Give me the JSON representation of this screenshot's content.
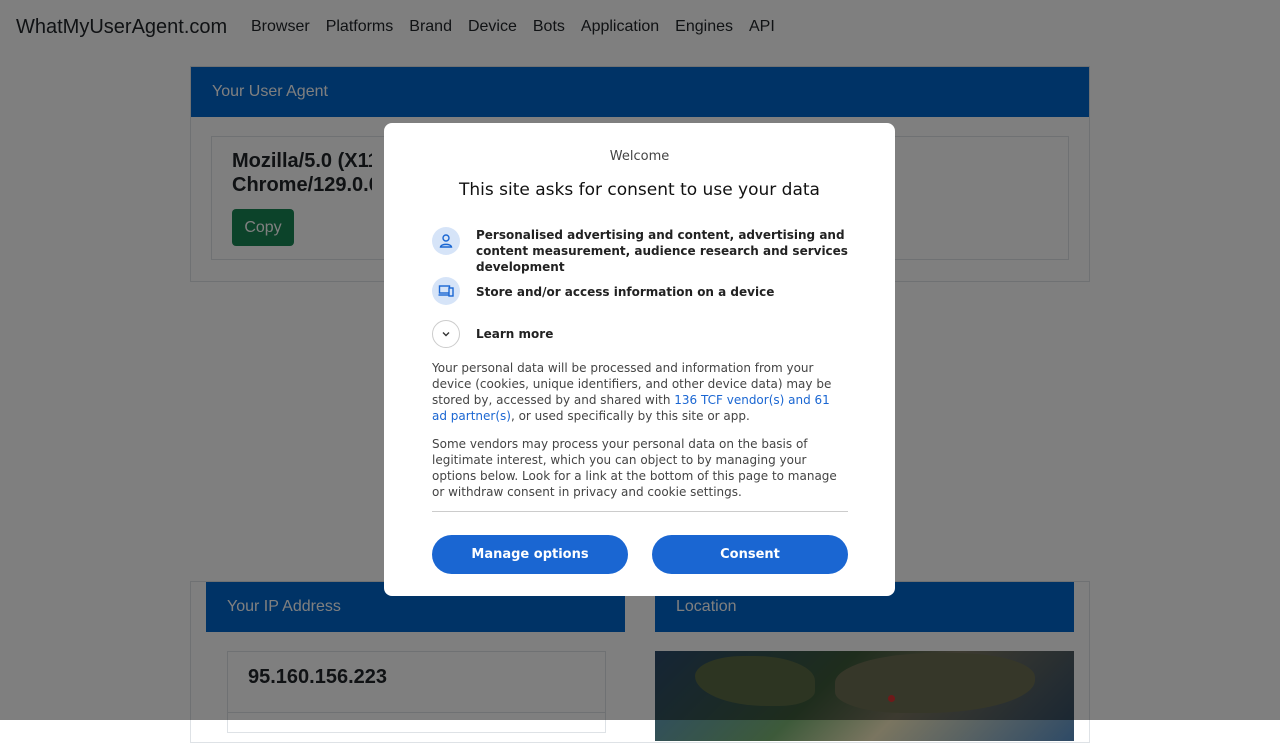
{
  "site": {
    "brand": "WhatMyUserAgent.com"
  },
  "nav": {
    "items": [
      "Browser",
      "Platforms",
      "Brand",
      "Device",
      "Bots",
      "Application",
      "Engines",
      "API"
    ]
  },
  "user_agent_card": {
    "title": "Your User Agent",
    "line1": "Mozilla/5.0 (X11; ",
    "line2": "Chrome/129.0.0.",
    "copy_label": "Copy"
  },
  "ip_card": {
    "title": "Your IP Address",
    "ip": "95.160.156.223"
  },
  "location_card": {
    "title": "Location"
  },
  "consent": {
    "welcome": "Welcome",
    "title": "This site asks for consent to use your data",
    "purposes": [
      {
        "icon": "person-icon",
        "text": "Personalised advertising and content, advertising and content measurement, audience research and services development"
      },
      {
        "icon": "devices-icon",
        "text": "Store and/or access information on a device"
      }
    ],
    "learn_more": "Learn more",
    "para1_before": "Your personal data will be processed and information from your device (cookies, unique identifiers, and other device data) may be stored by, accessed by and shared with ",
    "para1_link": "136 TCF vendor(s) and 61 ad partner(s)",
    "para1_after": ", or used specifically by this site or app.",
    "para2": "Some vendors may process your personal data on the basis of legitimate interest, which you can object to by managing your options below. Look for a link at the bottom of this page to manage or withdraw consent in privacy and cookie settings.",
    "manage_label": "Manage options",
    "consent_label": "Consent"
  },
  "colors": {
    "primary": "#0066cc",
    "copy": "#198754",
    "dialog_button": "#1a66d2",
    "overlay": "rgba(0,0,0,0.5)"
  }
}
